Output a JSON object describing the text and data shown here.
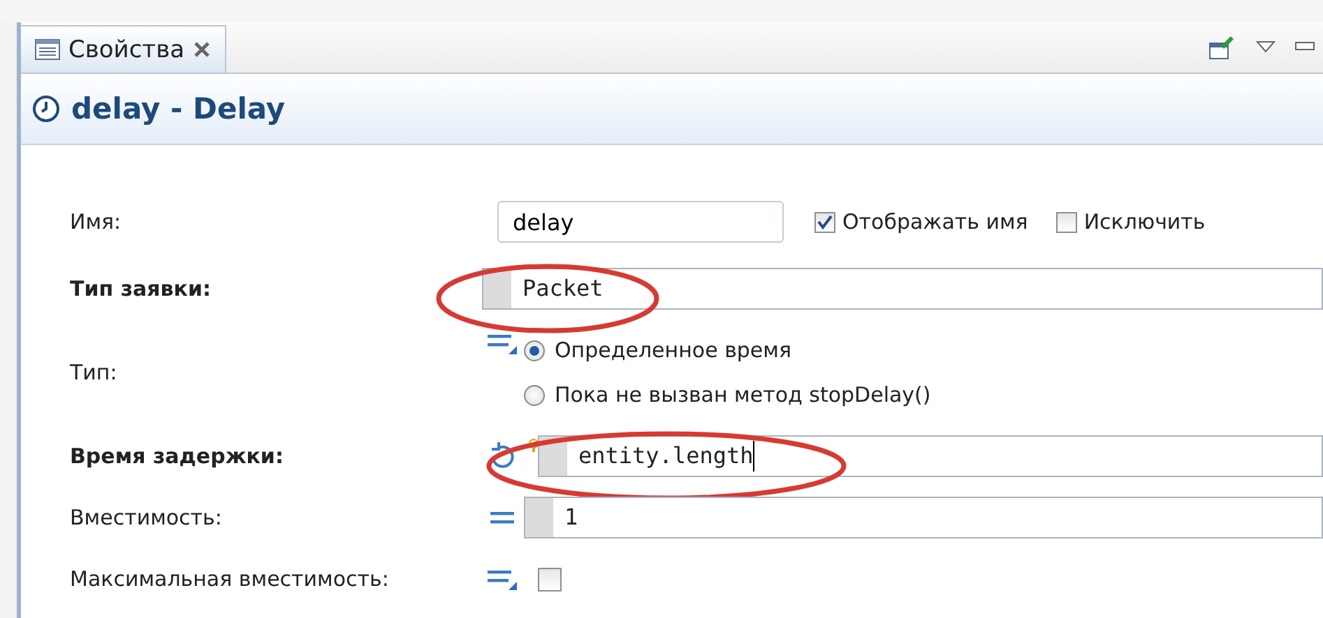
{
  "tab": {
    "label": "Свойства",
    "selected": true
  },
  "header": {
    "title": "delay - Delay"
  },
  "properties": [
    {
      "kind": "name",
      "label": "Имя:",
      "bold": false,
      "value": "delay",
      "options": [
        {
          "label": "Отображать имя",
          "checked": true
        },
        {
          "label": "Исключить",
          "checked": false
        }
      ]
    },
    {
      "kind": "type",
      "label": "Тип заявки:",
      "bold": true,
      "value": "Packet",
      "highlighted": true,
      "cursor": false
    },
    {
      "kind": "radio",
      "label": "Тип:",
      "bold": false,
      "options": [
        {
          "label": "Определенное время",
          "selected": true
        },
        {
          "label": "Пока не вызван метод stopDelay()",
          "selected": false
        }
      ]
    },
    {
      "kind": "expression",
      "label": "Время задержки:",
      "bold": true,
      "value": "entity.length",
      "highlighted": true,
      "cursor": true
    },
    {
      "kind": "value",
      "label": "Вместимость:",
      "bold": false,
      "value": "1",
      "highlighted": false,
      "cursor": false
    },
    {
      "kind": "check",
      "label": "Максимальная вместимость:",
      "bold": false,
      "checked": false
    }
  ]
}
